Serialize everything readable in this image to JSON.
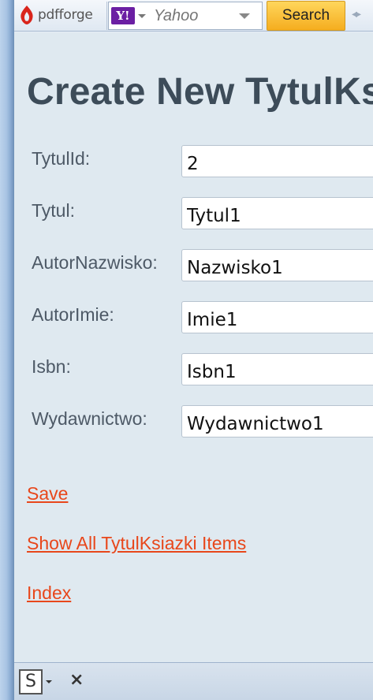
{
  "toolbar": {
    "brand": "pdfforge",
    "search_engine": "Y!",
    "search_placeholder": "Yahoo",
    "search_button": "Search"
  },
  "page": {
    "title": "Create New TytulKsiazki"
  },
  "form": {
    "fields": [
      {
        "label": "TytulId:",
        "value": "2"
      },
      {
        "label": "Tytul:",
        "value": "Tytul1"
      },
      {
        "label": "AutorNazwisko:",
        "value": "Nazwisko1"
      },
      {
        "label": "AutorImie:",
        "value": "Imie1"
      },
      {
        "label": "Isbn:",
        "value": "Isbn1"
      },
      {
        "label": "Wydawnictwo:",
        "value": "Wydawnictwo1"
      }
    ]
  },
  "links": {
    "save": "Save",
    "show_all": "Show All TytulKsiazki Items",
    "index": "Index"
  },
  "statusbar": {
    "s_icon": "S",
    "close": "×"
  },
  "colors": {
    "link": "#e8471b",
    "title": "#3d4c59",
    "background": "#dfe9f0"
  }
}
